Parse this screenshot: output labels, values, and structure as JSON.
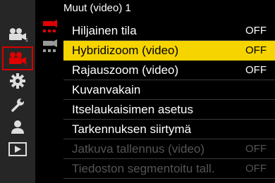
{
  "header": {
    "title": "Muut (video) 1"
  },
  "sidebar": {
    "items": [
      {
        "icon": "camera-mode-1-icon"
      },
      {
        "icon": "video-mode-2-icon",
        "active": true
      },
      {
        "icon": "gear-icon"
      },
      {
        "icon": "wrench-icon"
      },
      {
        "icon": "person-icon"
      },
      {
        "icon": "playback-icon"
      }
    ]
  },
  "subcategories": [
    {
      "icon": "video-submenu-active-icon"
    },
    {
      "icon": "video-submenu-icon"
    }
  ],
  "menu": {
    "items": [
      {
        "label": "Hiljainen tila",
        "value": "OFF",
        "state": "normal"
      },
      {
        "label": "Hybridizoom (video)",
        "value": "OFF",
        "state": "selected"
      },
      {
        "label": "Rajauszoom (video)",
        "value": "OFF",
        "state": "normal"
      },
      {
        "label": "Kuvanvakain",
        "value": "",
        "state": "normal"
      },
      {
        "label": "Itselaukaisimen asetus",
        "value": "",
        "state": "normal"
      },
      {
        "label": "Tarkennuksen siirtymä",
        "value": "",
        "state": "normal"
      },
      {
        "label": "Jatkuva tallennus (video)",
        "value": "OFF",
        "state": "disabled"
      },
      {
        "label": "Tiedoston segmentoitu tall.",
        "value": "OFF",
        "state": "disabled"
      }
    ]
  },
  "colors": {
    "accent": "#d60000",
    "highlight": "#f5d400",
    "sidebar": "#262626"
  }
}
